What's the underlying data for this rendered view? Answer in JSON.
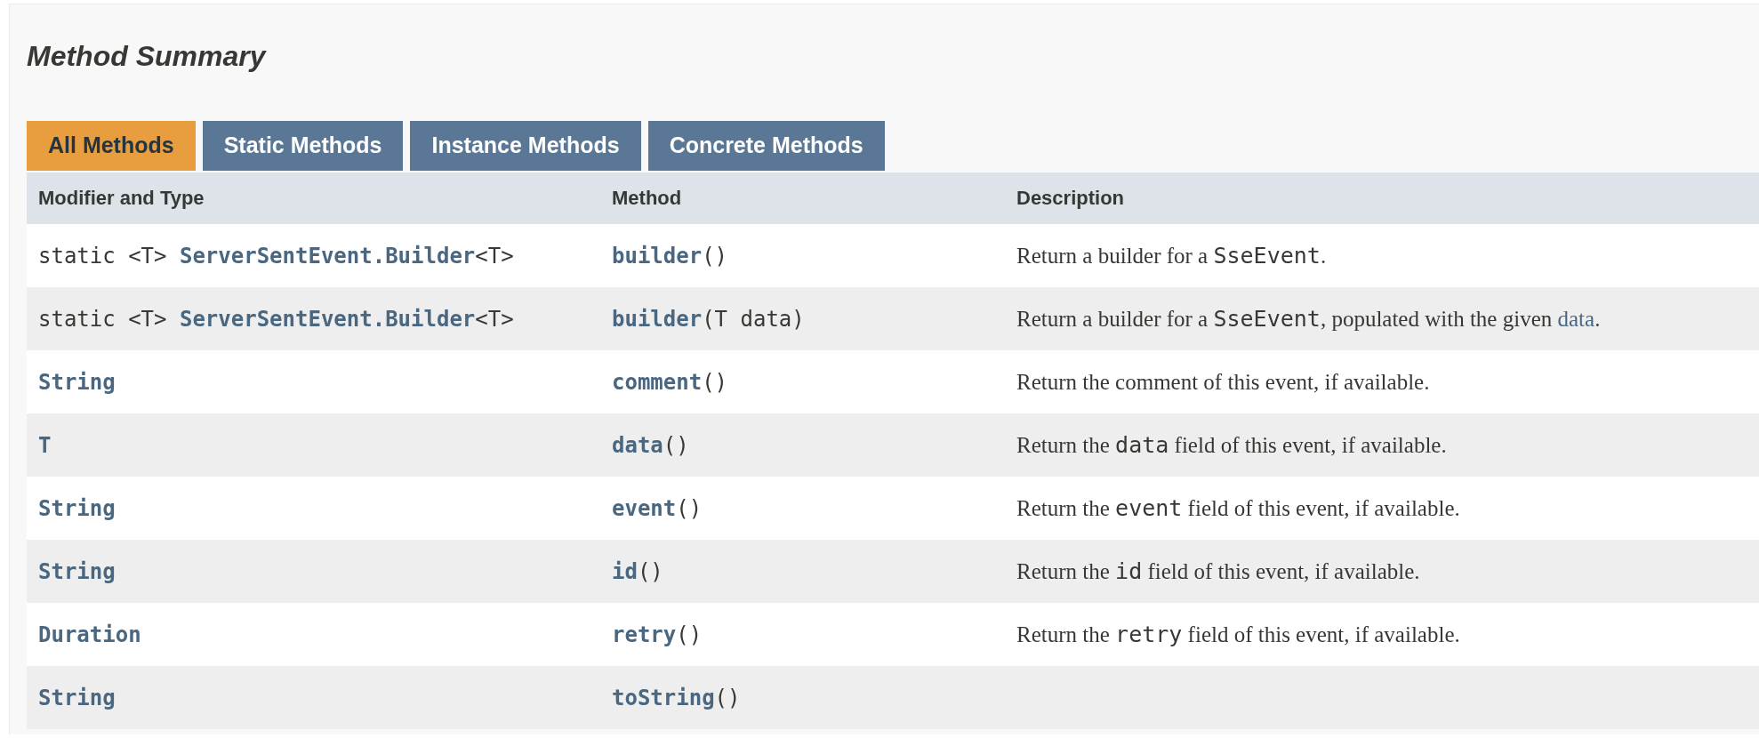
{
  "title": "Method Summary",
  "tabs": [
    {
      "label": "All Methods",
      "selected": true
    },
    {
      "label": "Static Methods",
      "selected": false
    },
    {
      "label": "Instance Methods",
      "selected": false
    },
    {
      "label": "Concrete Methods",
      "selected": false
    }
  ],
  "columns": [
    "Modifier and Type",
    "Method",
    "Description"
  ],
  "rows": [
    {
      "type": [
        {
          "kind": "code",
          "text": "static <T> "
        },
        {
          "kind": "link",
          "text": "ServerSentEvent.Builder"
        },
        {
          "kind": "code",
          "text": "<T>"
        }
      ],
      "method": [
        {
          "kind": "link",
          "text": "builder"
        },
        {
          "kind": "code",
          "text": "()"
        }
      ],
      "description": [
        {
          "kind": "plain",
          "text": "Return a builder for a "
        },
        {
          "kind": "code",
          "text": "SseEvent"
        },
        {
          "kind": "plain",
          "text": "."
        }
      ]
    },
    {
      "type": [
        {
          "kind": "code",
          "text": "static <T> "
        },
        {
          "kind": "link",
          "text": "ServerSentEvent.Builder"
        },
        {
          "kind": "code",
          "text": "<T>"
        }
      ],
      "method": [
        {
          "kind": "link",
          "text": "builder"
        },
        {
          "kind": "code",
          "text": "(T data)"
        }
      ],
      "description": [
        {
          "kind": "plain",
          "text": "Return a builder for a "
        },
        {
          "kind": "code",
          "text": "SseEvent"
        },
        {
          "kind": "plain",
          "text": ", populated with the given "
        },
        {
          "kind": "textlink",
          "text": "data"
        },
        {
          "kind": "plain",
          "text": "."
        }
      ]
    },
    {
      "type": [
        {
          "kind": "link",
          "text": "String"
        }
      ],
      "method": [
        {
          "kind": "link",
          "text": "comment"
        },
        {
          "kind": "code",
          "text": "()"
        }
      ],
      "description": [
        {
          "kind": "plain",
          "text": "Return the comment of this event, if available."
        }
      ]
    },
    {
      "type": [
        {
          "kind": "link",
          "text": "T"
        }
      ],
      "method": [
        {
          "kind": "link",
          "text": "data"
        },
        {
          "kind": "code",
          "text": "()"
        }
      ],
      "description": [
        {
          "kind": "plain",
          "text": "Return the "
        },
        {
          "kind": "code",
          "text": "data"
        },
        {
          "kind": "plain",
          "text": " field of this event, if available."
        }
      ]
    },
    {
      "type": [
        {
          "kind": "link",
          "text": "String"
        }
      ],
      "method": [
        {
          "kind": "link",
          "text": "event"
        },
        {
          "kind": "code",
          "text": "()"
        }
      ],
      "description": [
        {
          "kind": "plain",
          "text": "Return the "
        },
        {
          "kind": "code",
          "text": "event"
        },
        {
          "kind": "plain",
          "text": " field of this event, if available."
        }
      ]
    },
    {
      "type": [
        {
          "kind": "link",
          "text": "String"
        }
      ],
      "method": [
        {
          "kind": "link",
          "text": "id"
        },
        {
          "kind": "code",
          "text": "()"
        }
      ],
      "description": [
        {
          "kind": "plain",
          "text": "Return the "
        },
        {
          "kind": "code",
          "text": "id"
        },
        {
          "kind": "plain",
          "text": " field of this event, if available."
        }
      ]
    },
    {
      "type": [
        {
          "kind": "link",
          "text": "Duration"
        }
      ],
      "method": [
        {
          "kind": "link",
          "text": "retry"
        },
        {
          "kind": "code",
          "text": "()"
        }
      ],
      "description": [
        {
          "kind": "plain",
          "text": "Return the "
        },
        {
          "kind": "code",
          "text": "retry"
        },
        {
          "kind": "plain",
          "text": " field of this event, if available."
        }
      ]
    },
    {
      "type": [
        {
          "kind": "link",
          "text": "String"
        }
      ],
      "method": [
        {
          "kind": "link",
          "text": "toString"
        },
        {
          "kind": "code",
          "text": "()"
        }
      ],
      "description": []
    }
  ]
}
